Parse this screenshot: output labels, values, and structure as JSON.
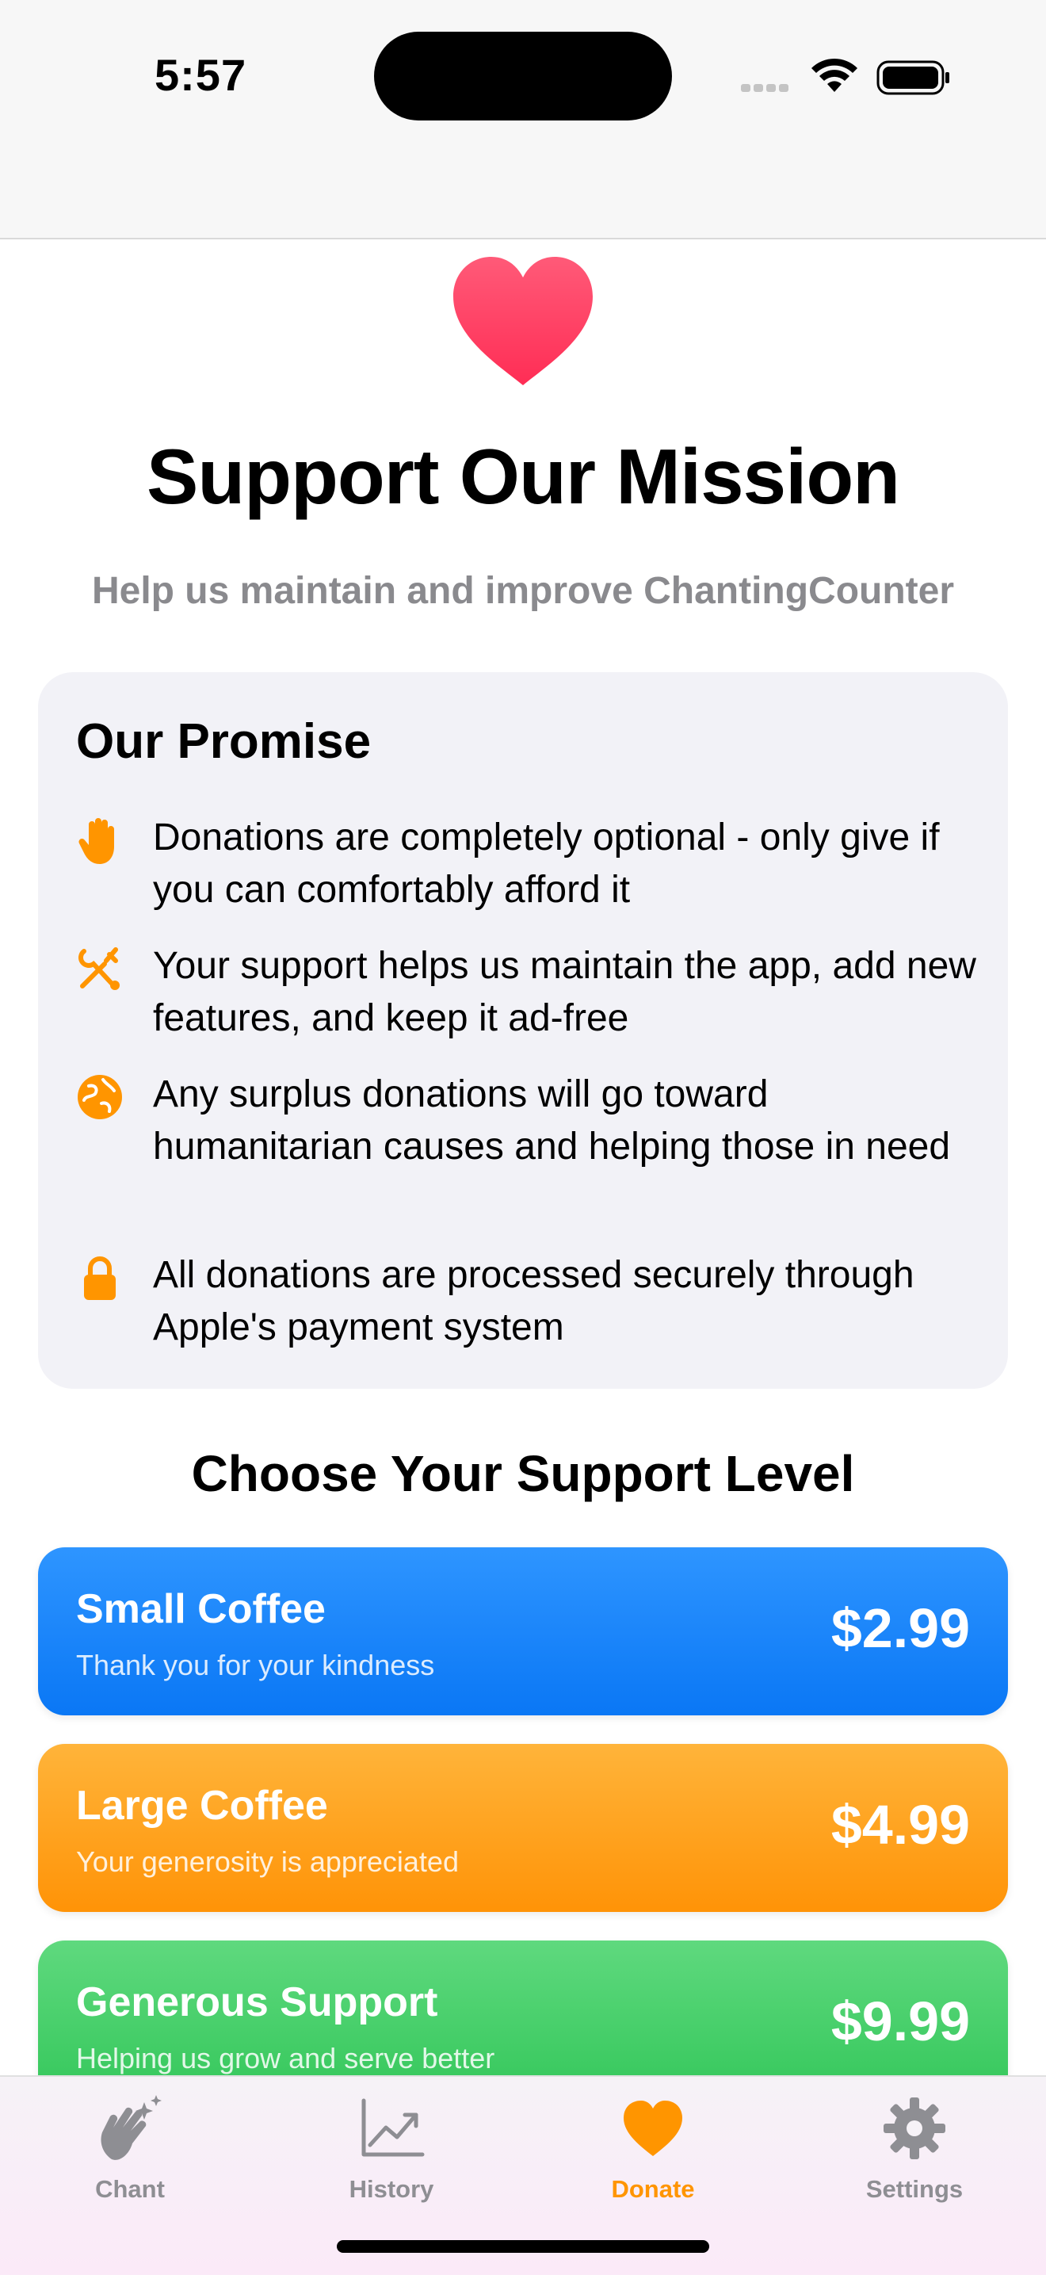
{
  "status_bar": {
    "time": "5:57"
  },
  "header": {
    "title": "Support Our Mission",
    "subtitle": "Help us maintain and improve ChantingCounter"
  },
  "promise": {
    "title": "Our Promise",
    "items": [
      {
        "icon": "hand-raised-icon",
        "text": "Donations are completely optional - only give if you can comfortably afford it"
      },
      {
        "icon": "wrench-screwdriver-icon",
        "text": "Your support helps us maintain the app, add new features, and keep it ad-free"
      },
      {
        "icon": "globe-icon",
        "text": "Any surplus donations will go toward humanitarian causes and helping those in need"
      },
      {
        "icon": "lock-icon",
        "text": "All donations are processed securely through Apple's payment system"
      }
    ]
  },
  "support": {
    "title": "Choose Your Support Level",
    "tiers": [
      {
        "name": "Small Coffee",
        "description": "Thank you for your kindness",
        "price": "$2.99",
        "color": "#0a7bff"
      },
      {
        "name": "Large Coffee",
        "description": "Your generosity is appreciated",
        "price": "$4.99",
        "color": "#ff9500"
      },
      {
        "name": "Generous Support",
        "description": "Helping us grow and serve better",
        "price": "$9.99",
        "color": "#34c759"
      }
    ]
  },
  "tabs": [
    {
      "label": "Chant",
      "icon": "clapping-hands-icon",
      "active": false
    },
    {
      "label": "History",
      "icon": "chart-line-icon",
      "active": false
    },
    {
      "label": "Donate",
      "icon": "heart-icon",
      "active": true
    },
    {
      "label": "Settings",
      "icon": "gear-icon",
      "active": false
    }
  ],
  "colors": {
    "accent": "#ff9500",
    "heart": "#ff2d55",
    "card_bg": "#f2f2f7"
  }
}
